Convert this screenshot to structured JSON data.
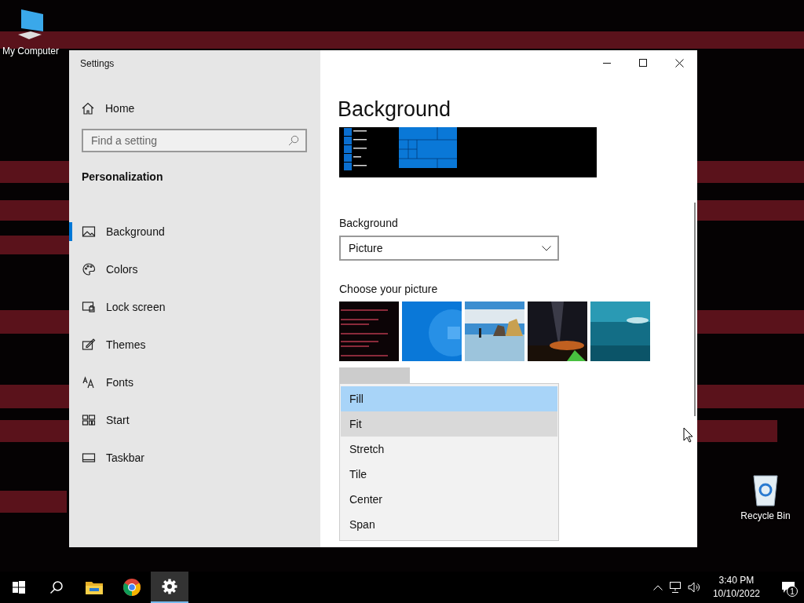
{
  "desktop_icons": [
    {
      "label": "My Computer",
      "kind": "computer"
    },
    {
      "label": "Recycle Bin",
      "kind": "recycle"
    }
  ],
  "window": {
    "title": "Settings"
  },
  "sidebar": {
    "home": "Home",
    "search": {
      "placeholder": "Find a setting"
    },
    "section": "Personalization",
    "items": [
      {
        "label": "Background",
        "kind": "picture",
        "selected": true
      },
      {
        "label": "Colors",
        "kind": "palette",
        "selected": false
      },
      {
        "label": "Lock screen",
        "kind": "lock",
        "selected": false
      },
      {
        "label": "Themes",
        "kind": "themes",
        "selected": false
      },
      {
        "label": "Fonts",
        "kind": "fonts",
        "selected": false
      },
      {
        "label": "Start",
        "kind": "start",
        "selected": false
      },
      {
        "label": "Taskbar",
        "kind": "taskbar",
        "selected": false
      }
    ]
  },
  "content": {
    "title": "Background",
    "background_label": "Background",
    "background_select": {
      "value": "Picture"
    },
    "choose_label": "Choose your picture",
    "fit_menu": {
      "options": [
        {
          "label": "Fill",
          "selected": true,
          "hovered": false
        },
        {
          "label": "Fit",
          "selected": false,
          "hovered": true
        },
        {
          "label": "Stretch",
          "selected": false,
          "hovered": false
        },
        {
          "label": "Tile",
          "selected": false,
          "hovered": false
        },
        {
          "label": "Center",
          "selected": false,
          "hovered": false
        },
        {
          "label": "Span",
          "selected": false,
          "hovered": false
        }
      ]
    }
  },
  "taskbar": {
    "apps": [
      {
        "kind": "start",
        "selected": false
      },
      {
        "kind": "search",
        "selected": false
      },
      {
        "kind": "folder",
        "selected": false
      },
      {
        "kind": "chrome",
        "selected": false
      },
      {
        "kind": "settings",
        "selected": true
      }
    ],
    "time": "3:40 PM",
    "date": "10/10/2022",
    "notification_count": "1"
  }
}
